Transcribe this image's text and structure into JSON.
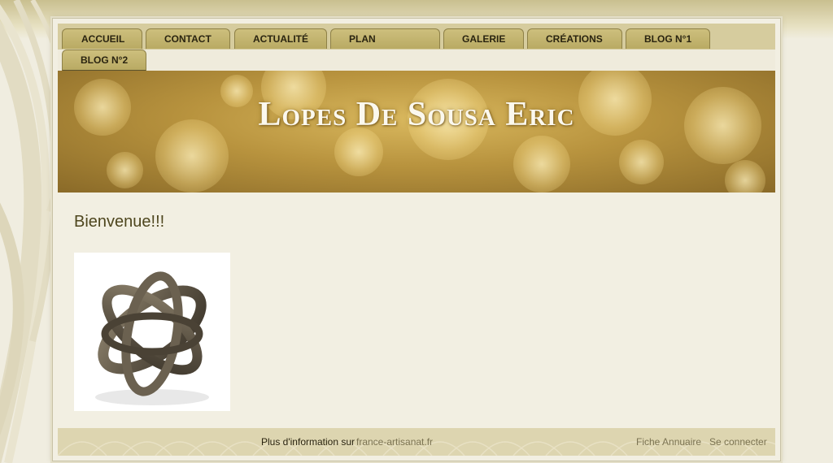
{
  "nav": {
    "tabs": [
      {
        "label": "Accueil"
      },
      {
        "label": "Contact"
      },
      {
        "label": "Actualité"
      },
      {
        "label": "Plan"
      },
      {
        "label": "Galerie"
      },
      {
        "label": "Créations"
      },
      {
        "label": "Blog N°1"
      },
      {
        "label": "Blog N°2"
      }
    ]
  },
  "header": {
    "title": "Lopes De Sousa Eric"
  },
  "main": {
    "welcome": "Bienvenue!!!"
  },
  "footer": {
    "info_label": "Plus d'information sur",
    "info_link": "france-artisanat.fr",
    "fiche": "Fiche Annuaire",
    "login": "Se connecter"
  },
  "colors": {
    "tab": "#c2b46d",
    "nav_band": "#d6cc9e",
    "page_bg": "#f0ede0",
    "heading": "#4e461e",
    "footer_bg": "#ddd5b0",
    "footer_link": "#7b7352"
  }
}
